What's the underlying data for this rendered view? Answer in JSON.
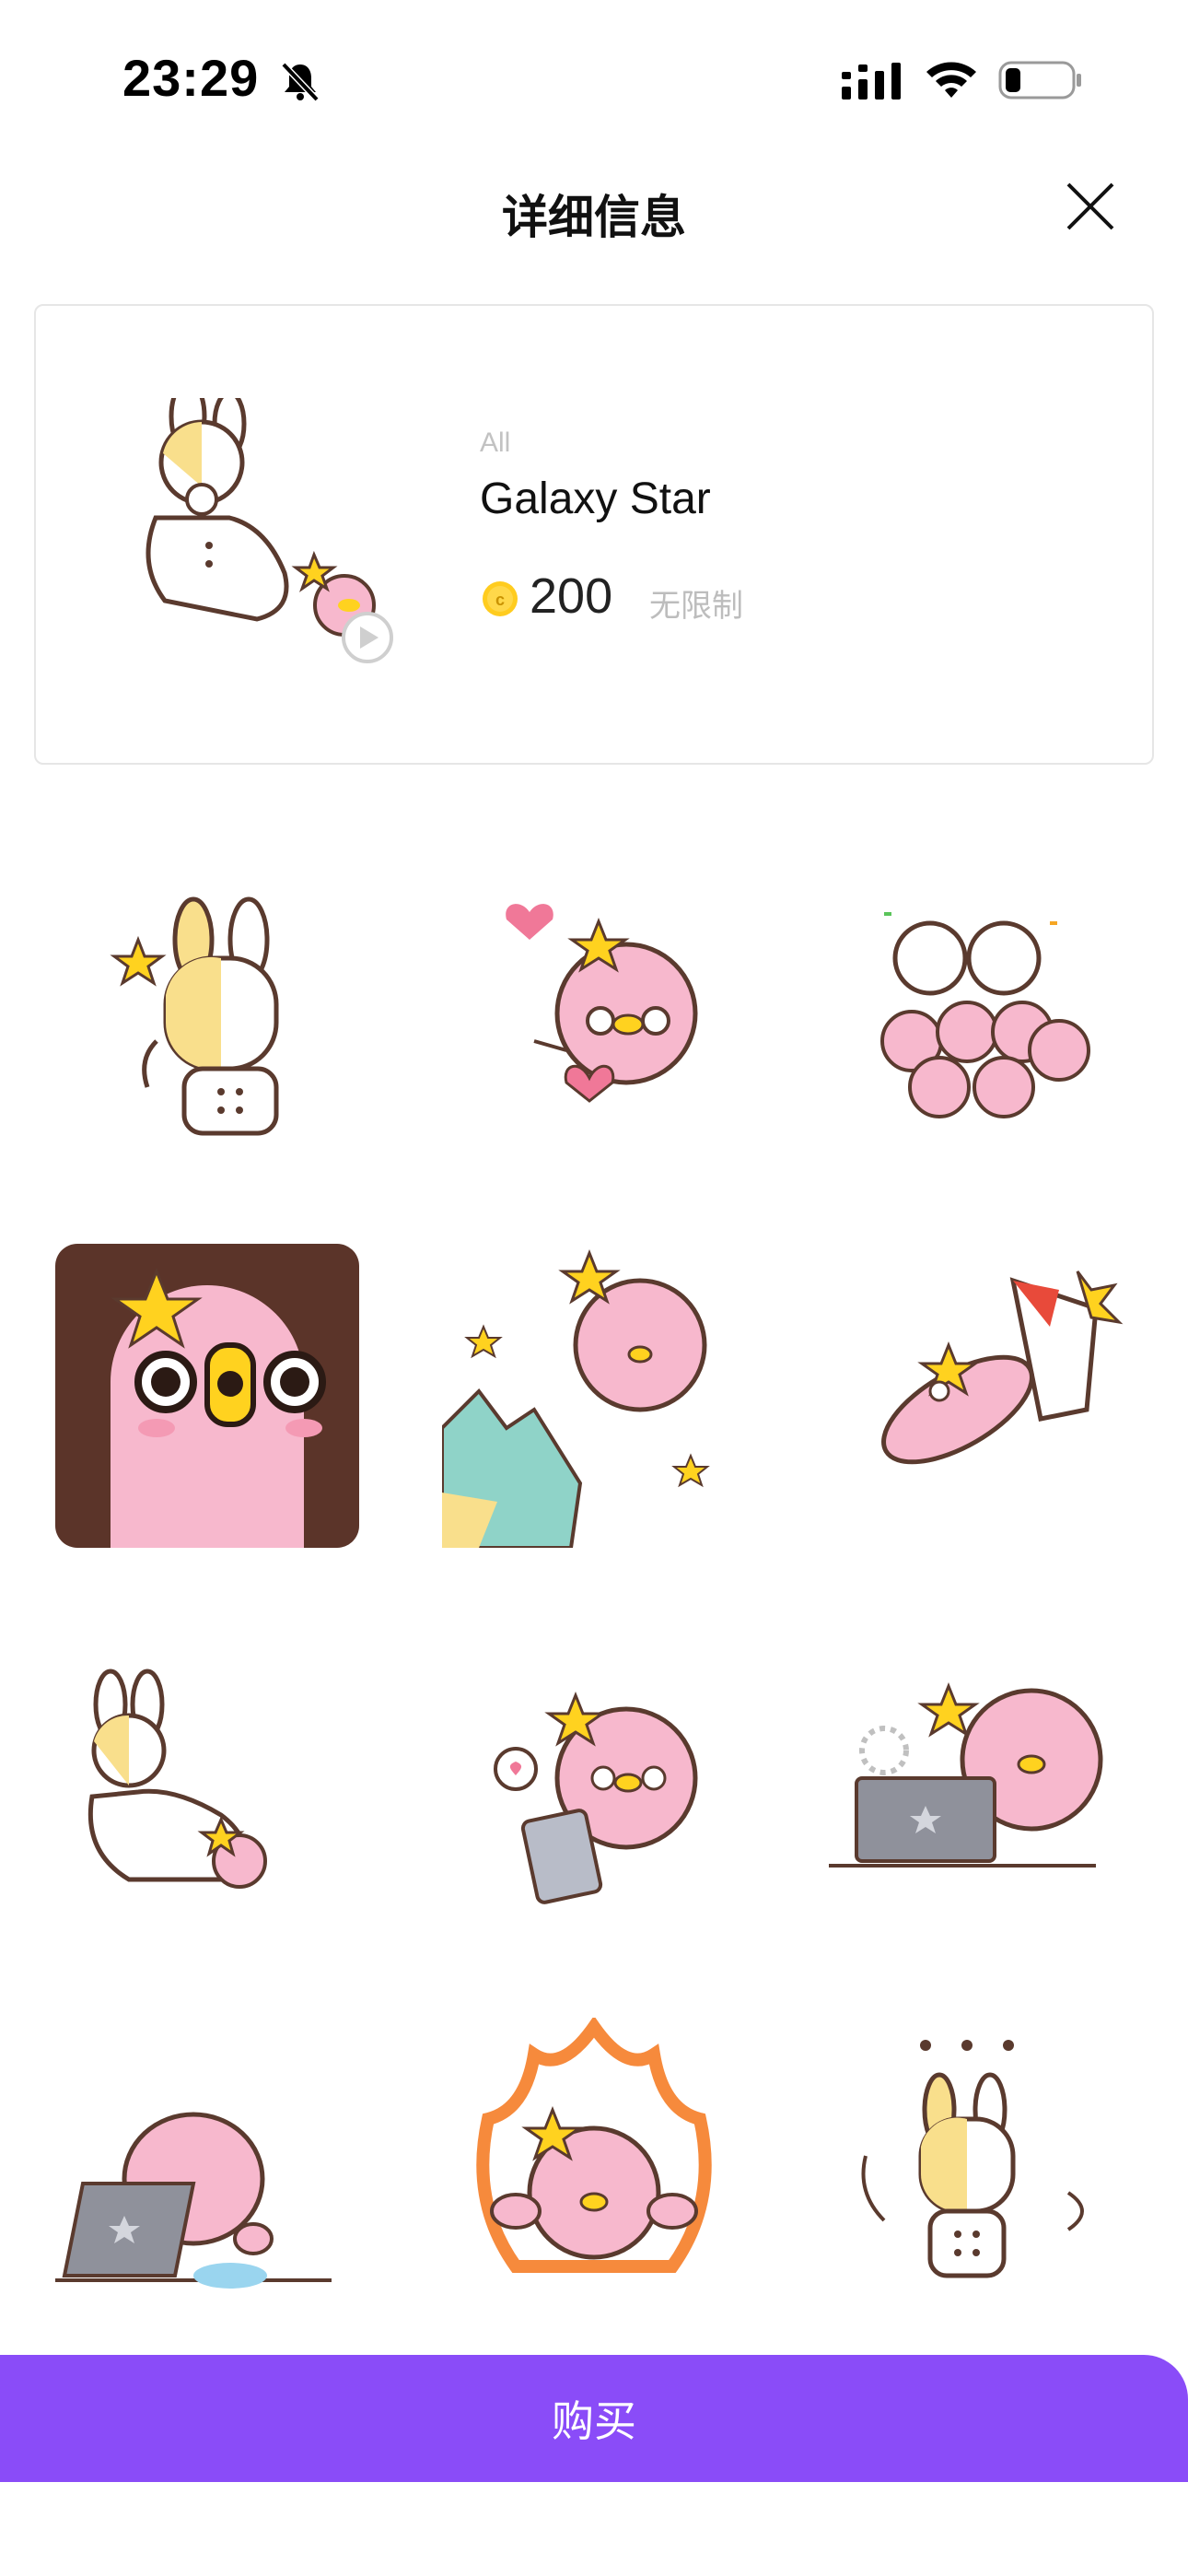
{
  "status_bar": {
    "time": "23:29"
  },
  "header": {
    "title": "详细信息"
  },
  "product": {
    "category": "All",
    "name": "Galaxy Star",
    "price": "200",
    "validity": "无限制"
  },
  "stickers": [
    {
      "icon": "rabbit-salute-sticker"
    },
    {
      "icon": "octopus-heart-sticker"
    },
    {
      "icon": "rabbit-cheer-crowd-sticker"
    },
    {
      "icon": "octopus-closeup-sticker"
    },
    {
      "icon": "octopus-earth-hatch-sticker"
    },
    {
      "icon": "octopus-rocket-sticker"
    },
    {
      "icon": "rabbit-sleeping-sticker"
    },
    {
      "icon": "octopus-phone-sticker"
    },
    {
      "icon": "octopus-laptop-sticker"
    },
    {
      "icon": "octopus-laptop-sleep-sticker"
    },
    {
      "icon": "octopus-fire-sticker"
    },
    {
      "icon": "rabbit-dots-sticker"
    }
  ],
  "buy_button": {
    "label": "购买"
  },
  "colors": {
    "accent": "#8a4cf8",
    "sticker_pink": "#f7b8cd",
    "star_yellow": "#ffd21f"
  }
}
